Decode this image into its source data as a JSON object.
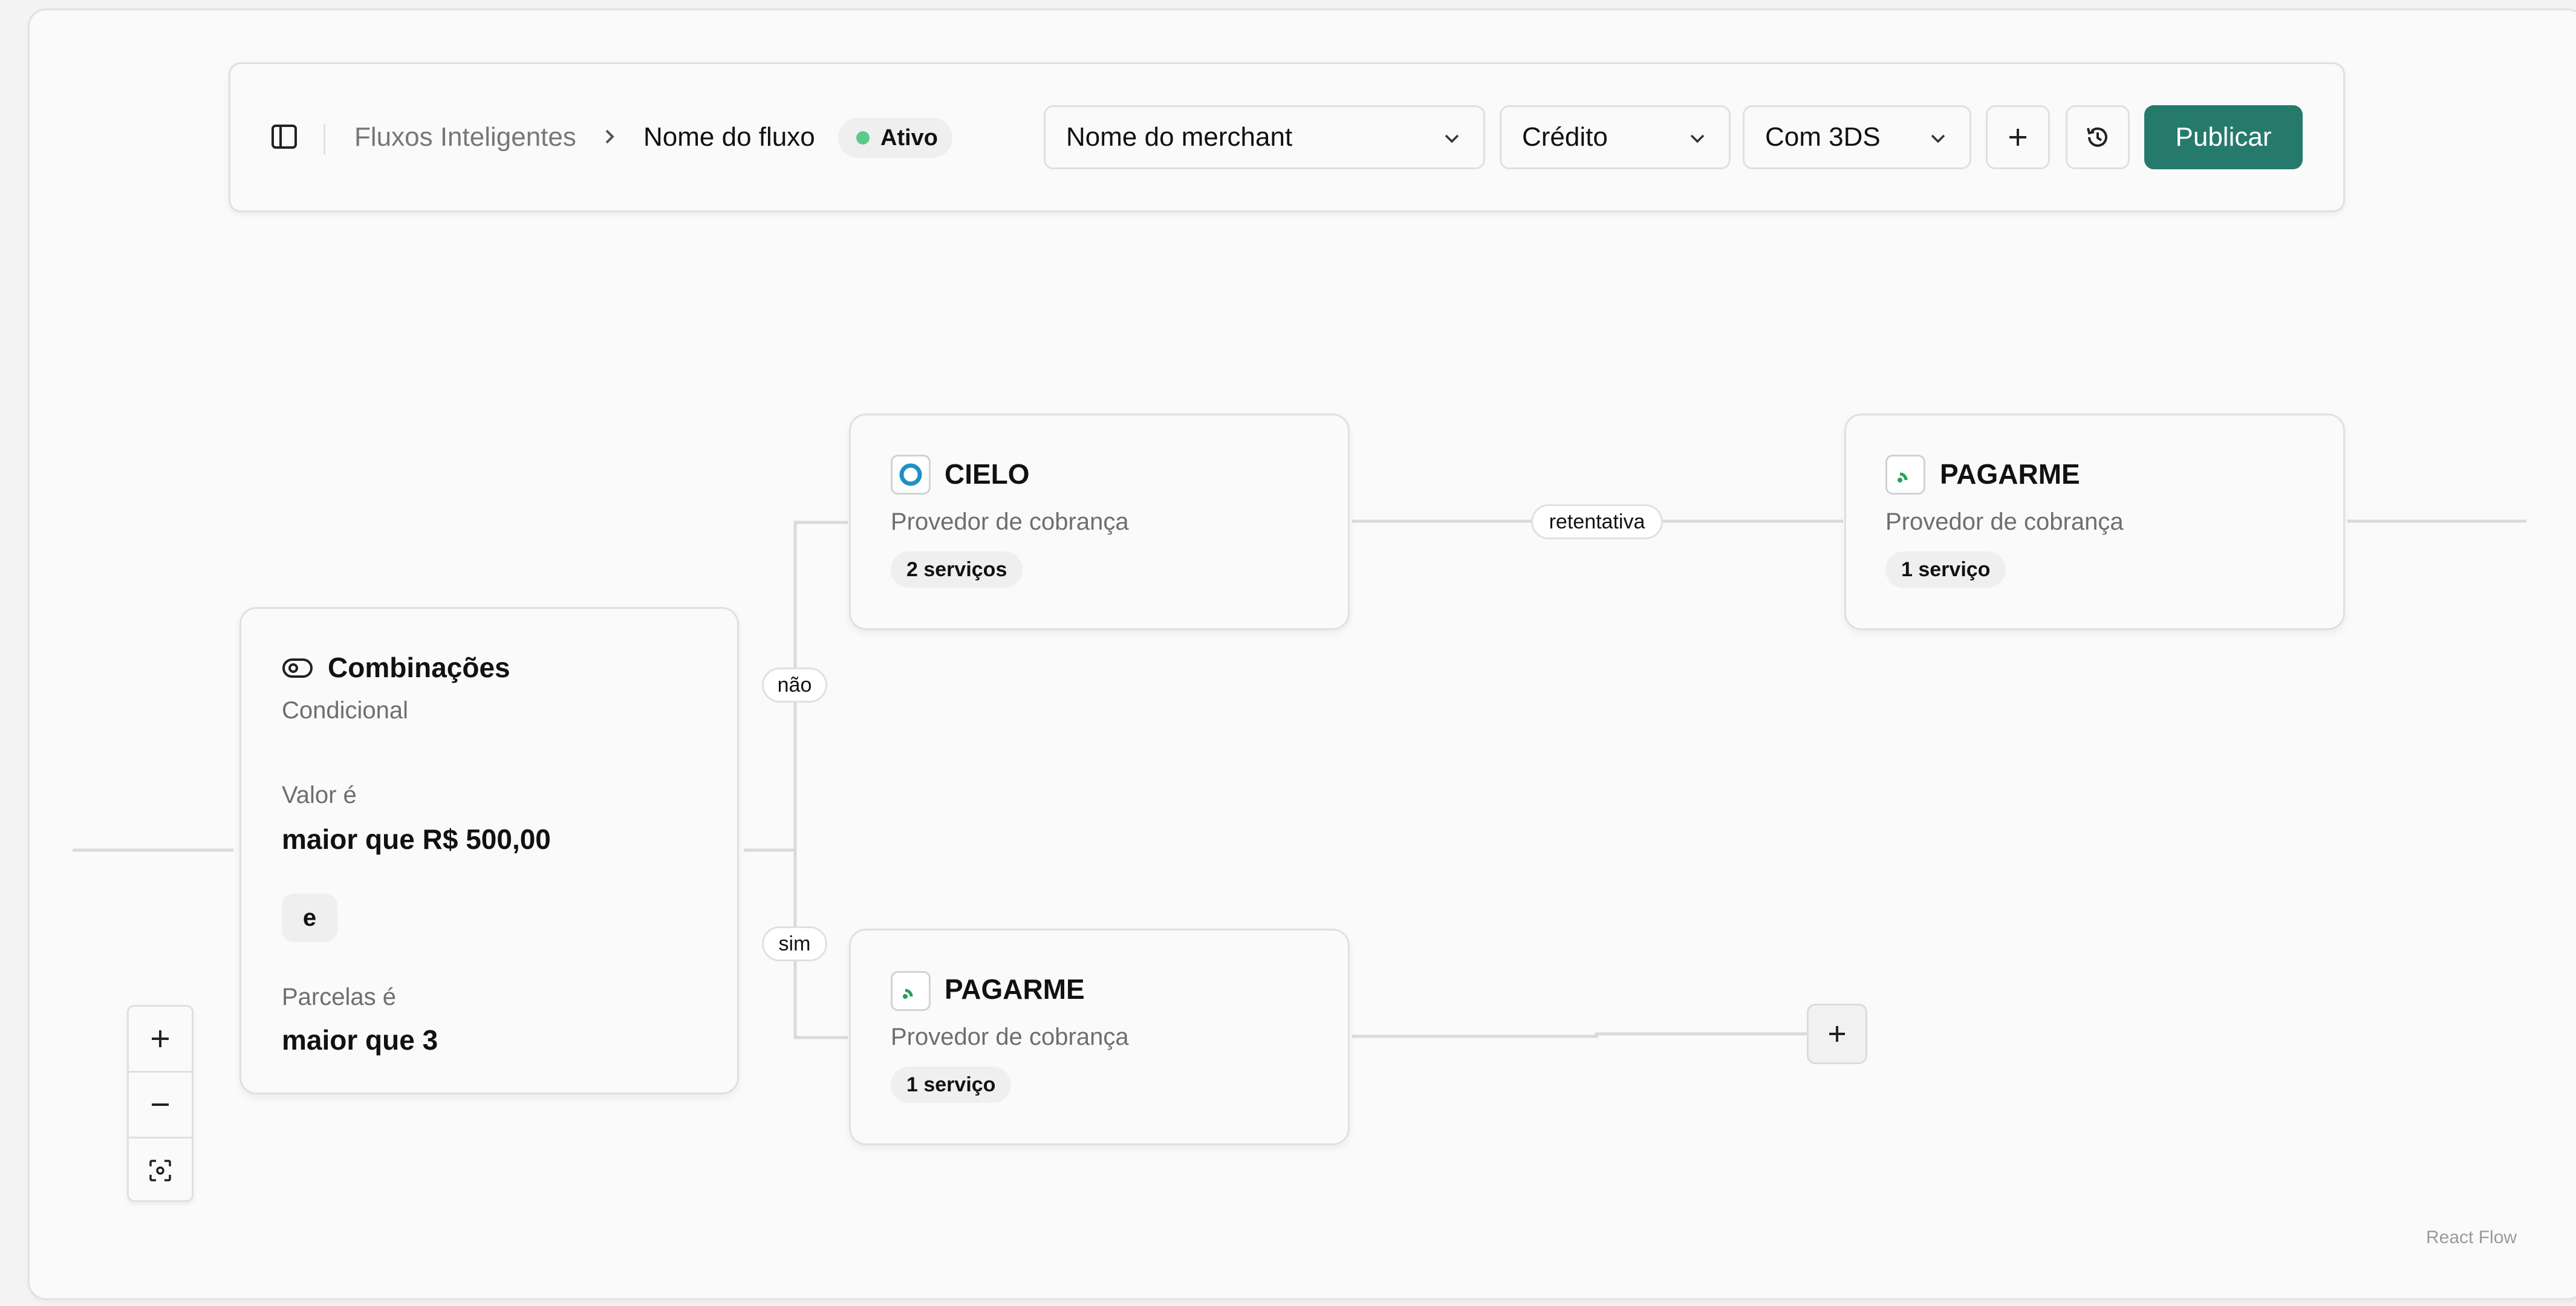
{
  "header": {
    "breadcrumb_root": "Fluxos Inteligentes",
    "breadcrumb_current": "Nome do fluxo",
    "status_label": "Ativo",
    "status_color": "#5cc98a",
    "merchant_select": "Nome do merchant",
    "payment_method_select": "Crédito",
    "auth_select": "Com 3DS",
    "publish_label": "Publicar",
    "publish_color": "#267a6c"
  },
  "nodes": {
    "condition": {
      "title": "Combinações",
      "subtitle": "Condicional",
      "rule1_label": "Valor é",
      "rule1_value": "maior que R$ 500,00",
      "operator": "e",
      "rule2_label": "Parcelas é",
      "rule2_value": "maior que 3"
    },
    "cielo": {
      "title": "CIELO",
      "subtitle": "Provedor de cobrança",
      "services": "2 serviços",
      "logo_icon": "ring-icon"
    },
    "pagarme_retry": {
      "title": "PAGARME",
      "subtitle": "Provedor de cobrança",
      "services": "1 serviço",
      "logo_icon": "signal-icon"
    },
    "pagarme_yes": {
      "title": "PAGARME",
      "subtitle": "Provedor de cobrança",
      "services": "1 serviço",
      "logo_icon": "signal-icon"
    }
  },
  "edges": {
    "no_label": "não",
    "yes_label": "sim",
    "retry_label": "retentativa"
  },
  "attribution": "React Flow"
}
